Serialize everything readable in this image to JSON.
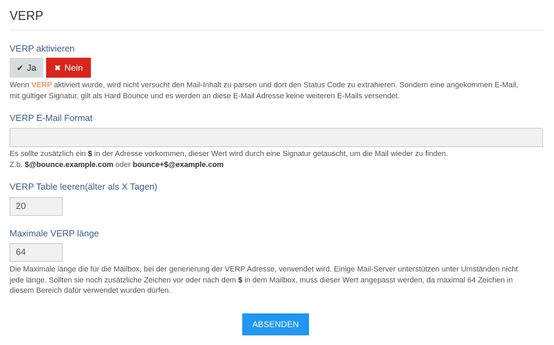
{
  "panel": {
    "title": "VERP"
  },
  "verp_activate": {
    "label": "VERP aktivieren",
    "yes_label": "Ja",
    "no_label": "Nein",
    "help_prefix": "Wenn ",
    "help_highlight": "VERP",
    "help_line1_rest": " aktiviert wurde, wird nicht versucht den Mail-Inhalt zu parsen und dort den Status Code zu extrahieren. Sondern eine angekommen E-Mail,",
    "help_line2": "mit gültiger Signatur, gilt als Hard Bounce und es werden an diese E-Mail Adresse keine weiteren E-Mails versendet."
  },
  "verp_format": {
    "label": "VERP E-Mail Format",
    "value": "",
    "help_line1_a": "Es sollte zusätzlich ein ",
    "help_line1_b": "$",
    "help_line1_c": " in der Adresse vorkommen, dieser Wert wird durch eine Signatur getauscht, um die Mail wieder zu finden.",
    "help_line2_a": "Z.b. ",
    "help_line2_b": "$@bounce.example.com",
    "help_line2_c": " oder ",
    "help_line2_d": "bounce+$@example.com"
  },
  "verp_table": {
    "label": "VERP Table leeren(älter als X Tagen)",
    "value": "20"
  },
  "verp_length": {
    "label": "Maximale VERP länge",
    "value": "64",
    "help_line1": "Die Maximale länge die für die Mailbox, bei der generierung der VERP Adresse, verwendet wird. Einige Mail-Server unterstützen unter Umständen nicht",
    "help_line2_a": "jede länge. Sollten sie noch zusätzliche Zeichen vor oder nach dem ",
    "help_line2_b": "$",
    "help_line2_c": " in dem Mailbox, muss dieser Wert angepasst werden, da maximal 64 Zeichen in",
    "help_line3": "diesem Bereich dafür verwendet wurden dürfen."
  },
  "submit": {
    "label": "ABSENDEN"
  },
  "colors": {
    "accent": "#2196f3",
    "danger": "#d9251c",
    "label": "#3a5a8c",
    "highlight": "#e8731b"
  },
  "icons": {
    "yes": "check-icon",
    "no": "times-icon"
  }
}
